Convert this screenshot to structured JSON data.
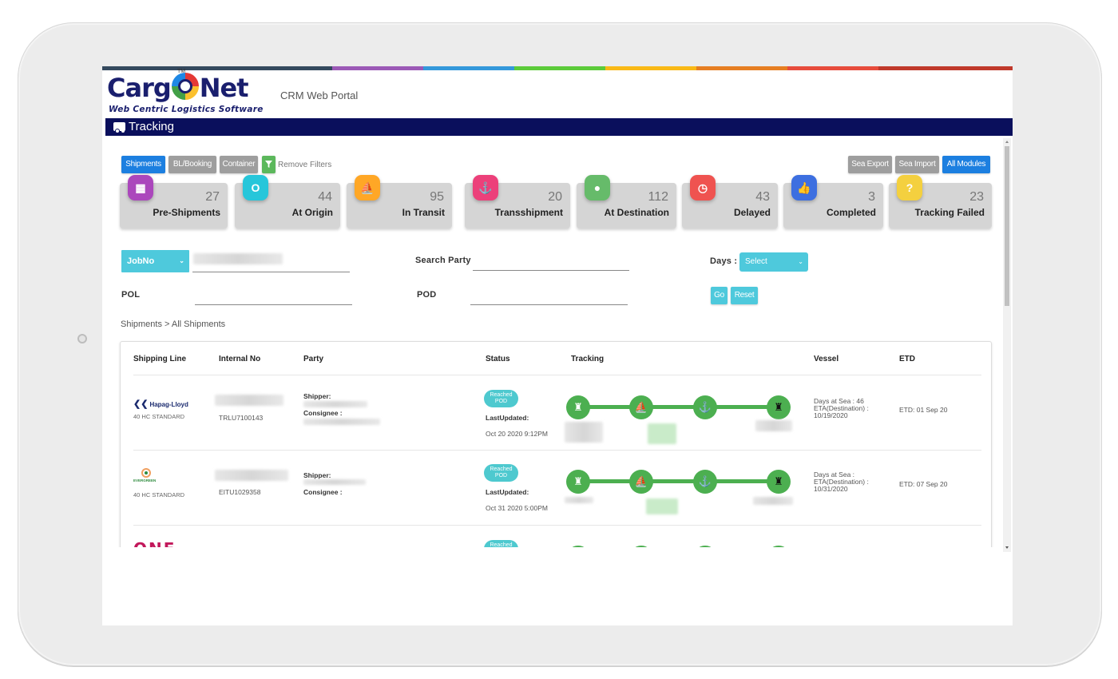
{
  "app": {
    "brand_main_left": "Carg",
    "brand_main_right": "Net",
    "brand_tm": "TM",
    "brand_tagline": "Web Centric Logistics Software",
    "portal_title": "CRM Web Portal",
    "page_title": "Tracking"
  },
  "rainbow_colors": [
    "#34495e",
    "#9b59b6",
    "#3498db",
    "#5ccb3a",
    "#f9b916",
    "#e67e22",
    "#e74c3c",
    "#c0392b"
  ],
  "tabs": {
    "shipments": "Shipments",
    "bl_booking": "BL/Booking",
    "container": "Container",
    "remove_filters": "Remove Filters"
  },
  "modules": {
    "sea_export": "Sea Export",
    "sea_import": "Sea Import",
    "all_modules": "All Modules"
  },
  "stats": [
    {
      "label": "Pre-Shipments",
      "count": "27",
      "icon": "grid-icon",
      "color": "#ab47bc"
    },
    {
      "label": "At Origin",
      "count": "44",
      "icon": "origin-icon",
      "color": "#26c6da"
    },
    {
      "label": "In Transit",
      "count": "95",
      "icon": "ship-icon",
      "color": "#ffa726"
    },
    {
      "label": "Transshipment",
      "count": "20",
      "icon": "anchor-icon",
      "color": "#ec407a"
    },
    {
      "label": "At Destination",
      "count": "112",
      "icon": "map-pin-icon",
      "color": "#66bb6a"
    },
    {
      "label": "Delayed",
      "count": "43",
      "icon": "clock-icon",
      "color": "#ef5350"
    },
    {
      "label": "Completed",
      "count": "3",
      "icon": "thumbs-up-icon",
      "color": "#3d6fe0"
    },
    {
      "label": "Tracking Failed",
      "count": "23",
      "icon": "question-icon",
      "color": "#f4d03f"
    }
  ],
  "filters": {
    "search_by": "JobNo",
    "search_party_label": "Search Party",
    "days_label": "Days :",
    "days_value": "Select",
    "pol_label": "POL",
    "pod_label": "POD",
    "go": "Go",
    "reset": "Reset"
  },
  "breadcrumb": "Shipments > All Shipments",
  "table": {
    "headers": [
      "Shipping Line",
      "Internal No",
      "Party",
      "Status",
      "Tracking",
      "Vessel",
      "ETD"
    ],
    "rows": [
      {
        "line": "Hapag-Lloyd",
        "container_type": "40 HC STANDARD",
        "internal_no": "TRLU7100143",
        "shipper_label": "Shipper:",
        "consignee_label": "Consignee :",
        "status": "Reached POD",
        "last_updated_label": "LastUpdated:",
        "last_updated": "Oct 20 2020 9:12PM",
        "days_at_sea": "Days at Sea : 46",
        "eta_label": "ETA(Destination) :",
        "eta": "10/19/2020",
        "etd": "ETD: 01 Sep 20"
      },
      {
        "line": "EVERGREEN",
        "container_type": "40 HC STANDARD",
        "internal_no": "EITU1029358",
        "shipper_label": "Shipper:",
        "consignee_label": "Consignee :",
        "status": "Reached POD",
        "last_updated_label": "LastUpdated:",
        "last_updated": "Oct 31 2020 5:00PM",
        "days_at_sea": "Days at Sea :",
        "eta_label": "ETA(Destination) :",
        "eta": "10/31/2020",
        "etd": "ETD: 07 Sep 20"
      },
      {
        "line": "ONE",
        "status": "Reached"
      }
    ]
  }
}
